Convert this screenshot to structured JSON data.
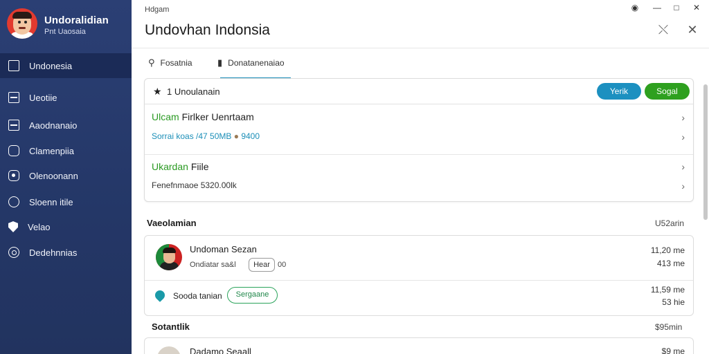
{
  "sidebar": {
    "brand_title": "Undoralidian",
    "brand_subtitle": "Pnt Uaosaia",
    "items": [
      {
        "label": "Undonesia",
        "icon": "square-icon"
      },
      {
        "label": "Ueotiie",
        "icon": "list-icon"
      },
      {
        "label": "Aaodnanaio",
        "icon": "grid-icon"
      },
      {
        "label": "Clamenpiia",
        "icon": "window-icon"
      },
      {
        "label": "Olenoonann",
        "icon": "lock-icon"
      },
      {
        "label": "Sloenn itile",
        "icon": "chat-icon"
      },
      {
        "label": "Velao",
        "icon": "shield-icon"
      },
      {
        "label": "Dedehnnias",
        "icon": "support-icon"
      }
    ]
  },
  "header": {
    "breadcrumb": "Hdgam",
    "title": "Undovhan Indonsia"
  },
  "tabs": [
    {
      "label": "Fosatnia",
      "icon": "search-icon"
    },
    {
      "label": "Donatanenaiao",
      "icon": "book-icon"
    }
  ],
  "card": {
    "header_text": "1 Unoulanain",
    "btn_primary": "Yerik",
    "btn_secondary": "Sogal",
    "row1_label_green": "Ulcam",
    "row1_label_rest": "Firlker Uenrtaam",
    "row2_text": "Sorrai koas /47 50MB",
    "row2_tail": "9400",
    "row3_label_green": "Ukardan",
    "row3_label_rest": "Fiile",
    "row4_text": "Fenefnmaoe 5320.00lk"
  },
  "section1": {
    "label": "Vaeolamian",
    "right": "U52arin"
  },
  "list": [
    {
      "name": "Undoman Sezan",
      "meta": "Ondiatar sa&l",
      "tag": "Hear",
      "tag_tail": "00",
      "time": "11,20 me",
      "size": "413 me"
    },
    {
      "name": "Sooda tanian",
      "tag": "Sergaane",
      "time": "11,59 me",
      "size": "53 hie"
    }
  ],
  "section2": {
    "label": "Sotantlik",
    "right": "$95min"
  },
  "list2": [
    {
      "name": "Dadamo Seaall",
      "time": "$9 me"
    }
  ],
  "colors": {
    "accent": "#1c8fb8",
    "success": "#2ea01f",
    "sidebar": "#263a6c"
  }
}
